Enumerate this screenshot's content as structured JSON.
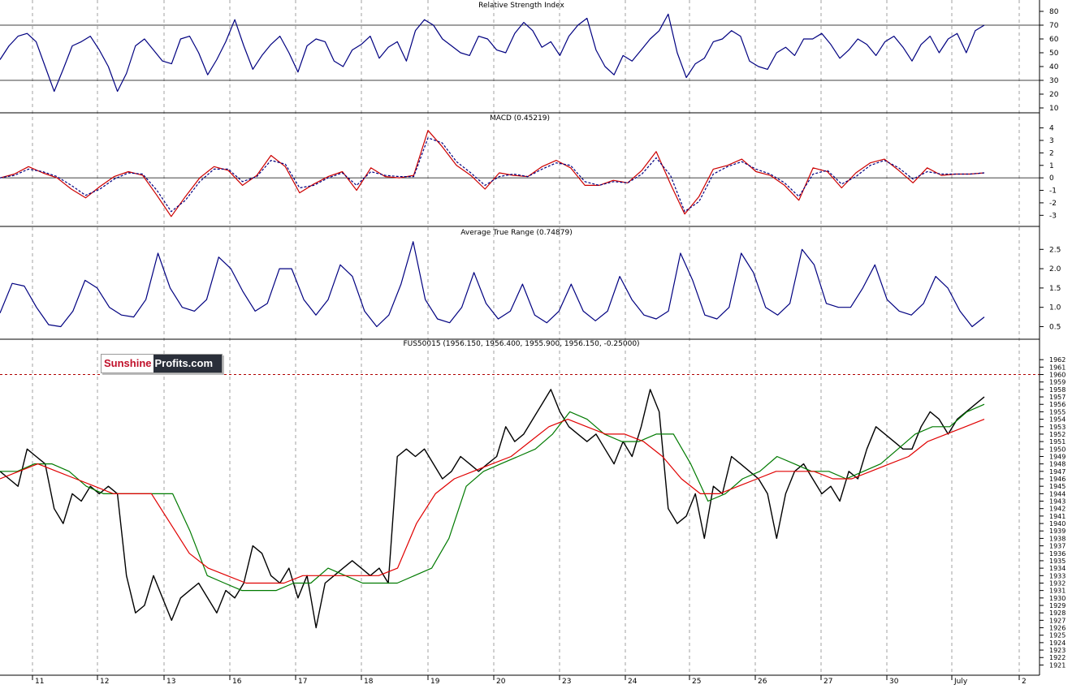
{
  "panels": {
    "rsi": {
      "title": "Relative Strength Index"
    },
    "macd": {
      "title": "MACD (0.45219)"
    },
    "atr": {
      "title": "Average True Range (0.74879)"
    },
    "price": {
      "title": "FUS50015 (1956.150, 1956.400, 1955.900, 1956.150, -0.25000)"
    }
  },
  "logo": {
    "part1": "Sunshine",
    "part2": "Profits.com"
  },
  "colors": {
    "price": "#000000",
    "ma_fast": "#007a00",
    "ma_slow": "#e00000",
    "indicator": "#000080",
    "signal": "#cc0000",
    "resistance": "#b00000",
    "grid": "#a0a0a0"
  },
  "chart_data": [
    {
      "type": "line",
      "name": "Relative Strength Index",
      "title": "Relative Strength Index",
      "x": [
        "11",
        "12",
        "13",
        "16",
        "17",
        "18",
        "19",
        "20",
        "23",
        "24",
        "25",
        "26",
        "27",
        "30",
        "July",
        "2"
      ],
      "ylim": [
        10,
        80
      ],
      "yticks": [
        80,
        70,
        60,
        50,
        40,
        30,
        20,
        10
      ],
      "reference_lines": [
        70,
        30
      ],
      "series": [
        {
          "values": [
            45,
            55,
            62,
            64,
            58,
            40,
            22,
            38,
            55,
            58,
            62,
            52,
            40,
            22,
            35,
            55,
            60,
            52,
            44,
            42,
            60,
            62,
            50,
            34,
            45,
            58,
            74,
            55,
            38,
            48,
            56,
            62,
            50,
            36,
            55,
            60,
            58,
            44,
            40,
            52,
            56,
            62,
            46,
            54,
            58,
            44,
            66,
            74,
            70,
            60,
            55,
            50,
            48,
            62,
            60,
            52,
            50,
            64,
            72,
            66,
            54,
            58,
            48,
            62,
            70,
            75,
            52,
            40,
            34,
            48,
            44,
            52,
            60,
            66,
            78,
            50,
            32,
            42,
            46,
            58,
            60,
            66,
            62,
            44,
            40,
            38,
            50,
            54,
            48,
            60,
            60,
            64,
            56,
            46,
            52,
            60,
            56,
            48,
            58,
            62,
            54,
            44,
            56,
            62,
            50,
            60,
            64,
            50,
            66,
            70
          ]
        }
      ]
    },
    {
      "type": "line",
      "name": "MACD",
      "title": "MACD (0.45219)",
      "x": [
        "11",
        "12",
        "13",
        "16",
        "17",
        "18",
        "19",
        "20",
        "23",
        "24",
        "25",
        "26",
        "27",
        "30",
        "July",
        "2"
      ],
      "ylim": [
        -3.5,
        4.3
      ],
      "yticks": [
        4,
        3,
        2,
        1,
        0,
        -1,
        -2,
        -3
      ],
      "reference_lines": [
        0
      ],
      "series": [
        {
          "values": [
            0.0,
            0.3,
            0.9,
            0.4,
            0.0,
            -0.9,
            -1.6,
            -0.7,
            0.1,
            0.5,
            0.2,
            -1.4,
            -3.1,
            -1.5,
            0.0,
            0.9,
            0.6,
            -0.6,
            0.2,
            1.8,
            0.9,
            -1.2,
            -0.5,
            0.1,
            0.5,
            -1.0,
            0.8,
            0.1,
            0.0,
            0.2,
            3.8,
            2.5,
            1.0,
            0.2,
            -0.9,
            0.4,
            0.2,
            0.1,
            0.9,
            1.4,
            0.8,
            -0.6,
            -0.6,
            -0.2,
            -0.4,
            0.6,
            2.1,
            -0.5,
            -2.9,
            -1.5,
            0.7,
            1.0,
            1.5,
            0.5,
            0.2,
            -0.6,
            -1.8,
            0.8,
            0.5,
            -0.8,
            0.4,
            1.2,
            1.5,
            0.6,
            -0.4,
            0.8,
            0.2,
            0.3,
            0.3,
            0.4
          ]
        },
        {
          "values": [
            0.0,
            0.2,
            0.7,
            0.5,
            0.1,
            -0.6,
            -1.4,
            -0.9,
            -0.1,
            0.4,
            0.3,
            -1.0,
            -2.7,
            -1.8,
            -0.3,
            0.7,
            0.7,
            -0.3,
            0.1,
            1.4,
            1.1,
            -0.8,
            -0.6,
            0.0,
            0.4,
            -0.6,
            0.5,
            0.2,
            0.1,
            0.1,
            3.2,
            2.8,
            1.3,
            0.4,
            -0.6,
            0.1,
            0.3,
            0.1,
            0.7,
            1.2,
            1.0,
            -0.3,
            -0.6,
            -0.3,
            -0.4,
            0.3,
            1.6,
            0.2,
            -2.7,
            -1.9,
            0.3,
            0.9,
            1.3,
            0.7,
            0.3,
            -0.4,
            -1.5,
            0.3,
            0.6,
            -0.5,
            0.1,
            1.0,
            1.4,
            0.8,
            -0.1,
            0.5,
            0.3,
            0.3,
            0.3,
            0.4
          ]
        }
      ]
    },
    {
      "type": "line",
      "name": "Average True Range",
      "title": "Average True Range (0.74879)",
      "x": [
        "11",
        "12",
        "13",
        "16",
        "17",
        "18",
        "19",
        "20",
        "23",
        "24",
        "25",
        "26",
        "27",
        "30",
        "July",
        "2"
      ],
      "ylim": [
        0.3,
        2.8
      ],
      "yticks": [
        2.5,
        2.0,
        1.5,
        1.0,
        0.5
      ],
      "series": [
        {
          "values": [
            0.85,
            1.62,
            1.55,
            1.0,
            0.55,
            0.5,
            0.9,
            1.7,
            1.5,
            1.0,
            0.8,
            0.75,
            1.2,
            2.4,
            1.5,
            1.0,
            0.9,
            1.2,
            2.3,
            2.0,
            1.4,
            0.9,
            1.1,
            2.0,
            2.0,
            1.2,
            0.8,
            1.2,
            2.1,
            1.8,
            0.9,
            0.5,
            0.8,
            1.6,
            2.7,
            1.2,
            0.7,
            0.6,
            1.0,
            1.9,
            1.1,
            0.7,
            0.9,
            1.6,
            0.8,
            0.6,
            0.9,
            1.6,
            0.9,
            0.65,
            0.9,
            1.8,
            1.2,
            0.8,
            0.7,
            0.9,
            2.4,
            1.7,
            0.8,
            0.7,
            1.0,
            2.4,
            1.9,
            1.0,
            0.8,
            1.1,
            2.5,
            2.1,
            1.1,
            1.0,
            1.0,
            1.5,
            2.1,
            1.2,
            0.9,
            0.8,
            1.1,
            1.8,
            1.5,
            0.9,
            0.5,
            0.75
          ]
        }
      ]
    },
    {
      "type": "line",
      "name": "FUS50015",
      "title": "FUS50015 (1956.150, 1956.400, 1955.900, 1956.150, -0.25000)",
      "x": [
        "11",
        "12",
        "13",
        "16",
        "17",
        "18",
        "19",
        "20",
        "23",
        "24",
        "25",
        "26",
        "27",
        "30",
        "July",
        "2"
      ],
      "ylim": [
        1920.5,
        1963
      ],
      "yticks": [
        1962,
        1961,
        1960,
        1959,
        1958,
        1957,
        1956,
        1955,
        1954,
        1953,
        1952,
        1951,
        1950,
        1949,
        1948,
        1947,
        1946,
        1945,
        1944,
        1943,
        1942,
        1941,
        1940,
        1939,
        1938,
        1937,
        1936,
        1935,
        1934,
        1933,
        1932,
        1931,
        1930,
        1929,
        1928,
        1927,
        1926,
        1925,
        1924,
        1923,
        1922,
        1921
      ],
      "reference_lines": [
        1960
      ],
      "series": [
        {
          "name": "",
          "values": [
            1947,
            1946,
            1945,
            1950,
            1949,
            1948,
            1942,
            1940,
            1944,
            1943,
            1945,
            1944,
            1945,
            1944,
            1933,
            1928,
            1929,
            1933,
            1930,
            1927,
            1930,
            1931,
            1932,
            1930,
            1928,
            1931,
            1930,
            1932,
            1937,
            1936,
            1933,
            1932,
            1934,
            1930,
            1933,
            1926,
            1932,
            1933,
            1934,
            1935,
            1934,
            1933,
            1934,
            1932,
            1949,
            1950,
            1949,
            1950,
            1948,
            1946,
            1947,
            1949,
            1948,
            1947,
            1948,
            1949,
            1953,
            1951,
            1952,
            1954,
            1956,
            1958,
            1955,
            1953,
            1952,
            1951,
            1952,
            1950,
            1948,
            1951,
            1949,
            1953,
            1958,
            1955,
            1942,
            1940,
            1941,
            1944,
            1938,
            1945,
            1944,
            1949,
            1948,
            1947,
            1946,
            1944,
            1938,
            1944,
            1947,
            1948,
            1946,
            1944,
            1945,
            1943,
            1947,
            1946,
            1950,
            1953,
            1952,
            1951,
            1950,
            1950,
            1953,
            1955,
            1954,
            1952,
            1954,
            1955,
            1956,
            1957
          ]
        },
        {
          "name": "",
          "values": [
            1947,
            1947,
            1948,
            1948,
            1947,
            1945,
            1944,
            1944,
            1944,
            1944,
            1944,
            1939,
            1933,
            1932,
            1931,
            1931,
            1931,
            1932,
            1932,
            1934,
            1933,
            1932,
            1932,
            1932,
            1933,
            1934,
            1938,
            1945,
            1947,
            1948,
            1949,
            1950,
            1952,
            1955,
            1954,
            1952,
            1951,
            1951,
            1952,
            1952,
            1948,
            1943,
            1944,
            1946,
            1947,
            1949,
            1948,
            1947,
            1947,
            1946,
            1947,
            1948,
            1950,
            1952,
            1953,
            1953,
            1955,
            1956
          ]
        },
        {
          "name": "",
          "values": [
            1946,
            1947,
            1948,
            1947,
            1946,
            1945,
            1944,
            1944,
            1944,
            1940,
            1936,
            1934,
            1933,
            1932,
            1932,
            1932,
            1933,
            1933,
            1933,
            1933,
            1933,
            1934,
            1940,
            1944,
            1946,
            1947,
            1948,
            1949,
            1951,
            1953,
            1954,
            1953,
            1952,
            1952,
            1951,
            1949,
            1946,
            1944,
            1944,
            1945,
            1946,
            1947,
            1947,
            1947,
            1946,
            1946,
            1947,
            1948,
            1949,
            1951,
            1952,
            1953,
            1954
          ]
        }
      ]
    }
  ]
}
